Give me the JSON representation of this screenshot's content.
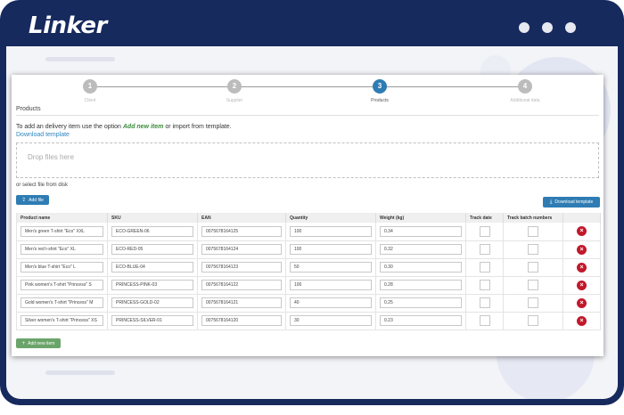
{
  "app": {
    "logo_text": "Linker"
  },
  "window": {
    "controls": [
      "dot-1",
      "dot-2",
      "dot-3"
    ]
  },
  "steps": [
    {
      "number": "1",
      "label": "Client",
      "active": false
    },
    {
      "number": "2",
      "label": "Supplier",
      "active": false
    },
    {
      "number": "3",
      "label": "Products",
      "active": true
    },
    {
      "number": "4",
      "label": "Additional data",
      "active": false
    }
  ],
  "section": {
    "title": "Products"
  },
  "instructions": {
    "before": "To add an delivery item use the option ",
    "option": "Add new item",
    "after": " or import from template."
  },
  "download_link": "Download template",
  "dropzone": {
    "text": "Drop files here"
  },
  "or_select": "or select file from disk",
  "buttons": {
    "add_file": "Add file",
    "download_template": "Download template",
    "add_item": "Add new item"
  },
  "table": {
    "headers": [
      "Product name",
      "SKU",
      "EAN",
      "Quantity",
      "Weight (kg)",
      "Track date",
      "Track batch numbers",
      ""
    ],
    "rows": [
      {
        "name": "Men's green T-shirt \"Eco\" XXL",
        "sku": "ECO-GREEN-06",
        "ean": "0075678164125",
        "qty": "100",
        "weight": "0.34"
      },
      {
        "name": "Men's red t-shirt \"Eco\" XL",
        "sku": "ECO-RED-05",
        "ean": "0075678164124",
        "qty": "100",
        "weight": "0.32"
      },
      {
        "name": "Men's blue T-shirt \"Eco\" L",
        "sku": "ECO-BLUE-04",
        "ean": "0075678164123",
        "qty": "50",
        "weight": "0.30"
      },
      {
        "name": "Pink women's T-shirt \"Princess\" S",
        "sku": "PRINCESS-PINK-03",
        "ean": "0075678164122",
        "qty": "100",
        "weight": "0.28"
      },
      {
        "name": "Gold women's T-shirt \"Princess\" M",
        "sku": "PRINCESS-GOLD-02",
        "ean": "0075678164121",
        "qty": "40",
        "weight": "0.25"
      },
      {
        "name": "Silver women's  T-shirt \"Princess\" XS",
        "sku": "PRINCESS-SILVER-01",
        "ean": "0075678164120",
        "qty": "30",
        "weight": "0.23"
      }
    ]
  },
  "colors": {
    "frame": "#172a5e",
    "accent_blue": "#2e7cb3",
    "accent_green": "#6aa46a",
    "delete_red": "#c2182b"
  }
}
